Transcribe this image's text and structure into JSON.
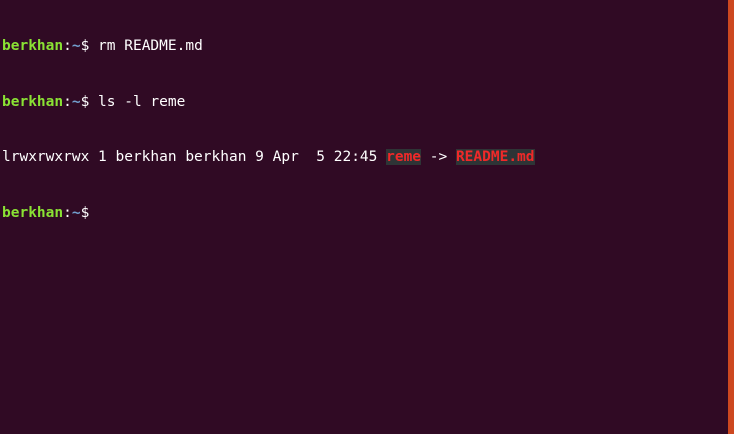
{
  "terminal": {
    "lines": [
      {
        "user": "berkhan",
        "colon": ":",
        "path": "~",
        "prompt_symbol": "$ ",
        "command": "rm README.md"
      },
      {
        "user": "berkhan",
        "colon": ":",
        "path": "~",
        "prompt_symbol": "$ ",
        "command": "ls -l reme"
      },
      {
        "listing": "lrwxrwxrwx 1 berkhan berkhan 9 Apr  5 22:45 ",
        "link_name": "reme",
        "arrow": " -> ",
        "link_target": "README.md"
      },
      {
        "user": "berkhan",
        "colon": ":",
        "path": "~",
        "prompt_symbol": "$ ",
        "command": ""
      }
    ]
  },
  "colors": {
    "background": "#300a24",
    "prompt_user": "#8ae234",
    "prompt_path": "#729fcf",
    "broken_link_fg": "#ef2929",
    "broken_link_bg": "#2e3436",
    "scroll_edge": "#e95420"
  }
}
